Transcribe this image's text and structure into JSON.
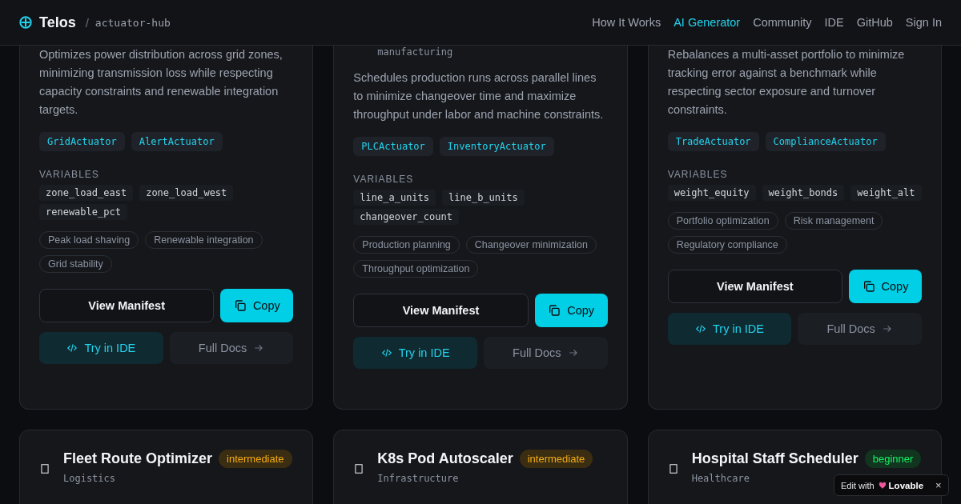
{
  "header": {
    "logo": "Telos",
    "separator": "/",
    "path": "actuator-hub",
    "nav": [
      {
        "label": "How It Works",
        "selected": false
      },
      {
        "label": "AI Generator",
        "selected": true
      },
      {
        "label": "Community",
        "selected": false
      },
      {
        "label": "IDE",
        "selected": false
      },
      {
        "label": "GitHub",
        "selected": false
      },
      {
        "label": "Sign In",
        "selected": false
      }
    ]
  },
  "cards": [
    {
      "description": "Optimizes power distribution across grid zones, minimizing transmission loss while respecting capacity constraints and renewable integration targets.",
      "actuators": [
        "GridActuator",
        "AlertActuator"
      ],
      "variables_label": "VARIABLES",
      "variables": [
        "zone_load_east",
        "zone_load_west",
        "renewable_pct"
      ],
      "tags": [
        "Peak load shaving",
        "Renewable integration",
        "Grid stability"
      ],
      "view": "View Manifest",
      "copy": "Copy",
      "try": "Try in IDE",
      "docs": "Full Docs"
    },
    {
      "category": "manufacturing",
      "description": "Schedules production runs across parallel lines to minimize changeover time and maximize throughput under labor and machine constraints.",
      "actuators": [
        "PLCActuator",
        "InventoryActuator"
      ],
      "variables_label": "VARIABLES",
      "variables": [
        "line_a_units",
        "line_b_units",
        "changeover_count"
      ],
      "tags": [
        "Production planning",
        "Changeover minimization",
        "Throughput optimization"
      ],
      "view": "View Manifest",
      "copy": "Copy",
      "try": "Try in IDE",
      "docs": "Full Docs"
    },
    {
      "description": "Rebalances a multi-asset portfolio to minimize tracking error against a benchmark while respecting sector exposure and turnover constraints.",
      "actuators": [
        "TradeActuator",
        "ComplianceActuator"
      ],
      "variables_label": "VARIABLES",
      "variables": [
        "weight_equity",
        "weight_bonds",
        "weight_alt"
      ],
      "tags": [
        "Portfolio optimization",
        "Risk management",
        "Regulatory compliance"
      ],
      "view": "View Manifest",
      "copy": "Copy",
      "try": "Try in IDE",
      "docs": "Full Docs"
    }
  ],
  "next_cards": [
    {
      "title": "Fleet Route Optimizer",
      "level": "intermediate",
      "color": "#3a2d12",
      "category": "Logistics"
    },
    {
      "title": "K8s Pod Autoscaler",
      "level": "intermediate",
      "color": "#3a2d12",
      "category": "Infrastructure"
    },
    {
      "title": "Hospital Staff Scheduler",
      "level": "beginner",
      "color": "#11351e",
      "category": "Healthcare"
    }
  ],
  "edit_badge": {
    "prefix": "Edit with",
    "brand": "Lovable",
    "close": "×"
  }
}
